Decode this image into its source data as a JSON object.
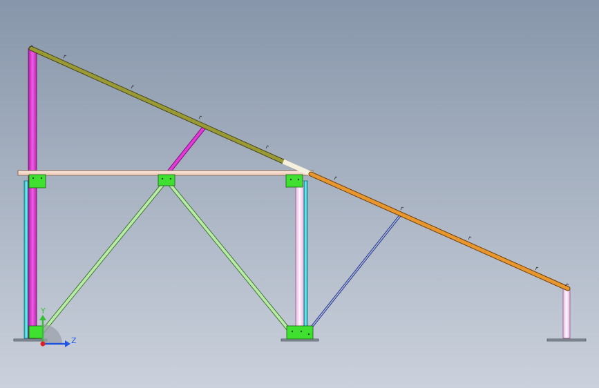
{
  "viewport": {
    "background_top": "#8796aa",
    "background_bottom": "#cbd1dc"
  },
  "colors": {
    "magenta_column": "#e23ad8",
    "rafter_upper": "#9a9a35",
    "rafter_lower": "#e8962e",
    "beam": "#f1d2c0",
    "cyan_post": "#35d7dc",
    "pale_column": "#f2d6ef",
    "brace_green": "#b7eca4",
    "brace_blue": "#5566b4",
    "brace_magenta": "#e23ad8",
    "plate_green": "#3fe030",
    "base_plate": "#8c95a0",
    "axis_y": "#35c035",
    "axis_z": "#2255e0",
    "origin": "#e02020"
  },
  "axis_triad": {
    "y_label": "Y",
    "z_label": "Z"
  },
  "icons": {
    "triad": "coordinate-triad-icon"
  }
}
